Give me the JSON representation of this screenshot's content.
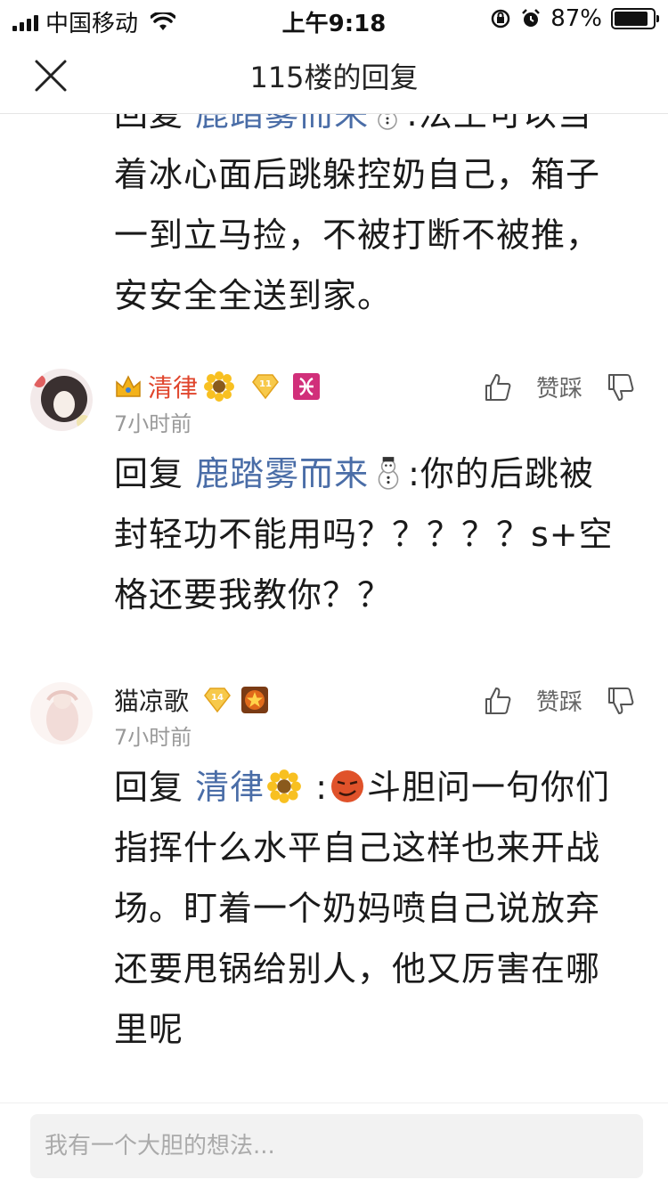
{
  "status_bar": {
    "carrier": "中国移动",
    "time": "上午9:18",
    "battery": "87%",
    "battery_level": 0.87
  },
  "header": {
    "title": "115楼的回复"
  },
  "top_reply": {
    "prefix": "回复",
    "mention": "鹿踏雾而来",
    "rest": ":法王可以当着冰心面后跳躲控奶自己，箱子一到立马捡，不被打断不被推，安安全全送到家。"
  },
  "comments": [
    {
      "username": "清律",
      "badge_level": "11",
      "time": "7小时前",
      "like_label": "赞",
      "dislike_label": "踩",
      "reply_prefix": "回复",
      "reply_mention": "鹿踏雾而来",
      "reply_rest": ":你的后跳被封轻功不能用吗？？？？？s+空格还要我教你？？"
    },
    {
      "username": "猫凉歌",
      "badge_level": "14",
      "time": "7小时前",
      "like_label": "赞",
      "dislike_label": "踩",
      "reply_prefix": "回复",
      "reply_mention": "清律",
      "reply_rest": "斗胆问一句你们指挥什么水平自己这样也来开战场。盯着一个奶妈喷自己说放弃还要甩锅给别人，他又厉害在哪里呢"
    }
  ],
  "input": {
    "placeholder": "我有一个大胆的想法..."
  }
}
